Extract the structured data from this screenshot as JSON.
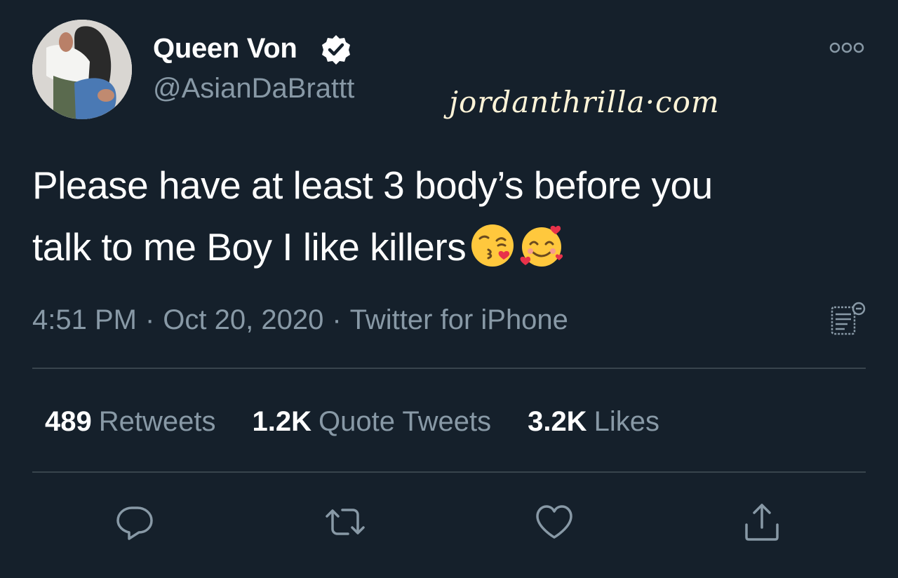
{
  "author": {
    "display_name": "Queen Von",
    "handle": "@AsianDaBrattt",
    "verified": true,
    "avatar": "profile-photo"
  },
  "watermark": "jordanthrilla·com",
  "tweet": {
    "text_line1": "Please have at least 3 body’s before you",
    "text_line2": "talk to me Boy I like killers",
    "emojis": [
      "face-blowing-a-kiss",
      "smiling-face-with-hearts"
    ]
  },
  "meta": {
    "time": "4:51 PM",
    "separator": "·",
    "date": "Oct 20, 2020",
    "source": "Twitter for iPhone"
  },
  "stats": {
    "retweets_count": "489",
    "retweets_label": "Retweets",
    "quotes_count": "1.2K",
    "quotes_label": "Quote Tweets",
    "likes_count": "3.2K",
    "likes_label": "Likes"
  },
  "actions": [
    "reply-icon",
    "retweet-icon",
    "like-icon",
    "share-icon"
  ],
  "colors": {
    "background": "#15202b",
    "text": "#ffffff",
    "secondary_text": "#8899a6",
    "divider": "#38444d",
    "watermark": "#fff4d8"
  }
}
